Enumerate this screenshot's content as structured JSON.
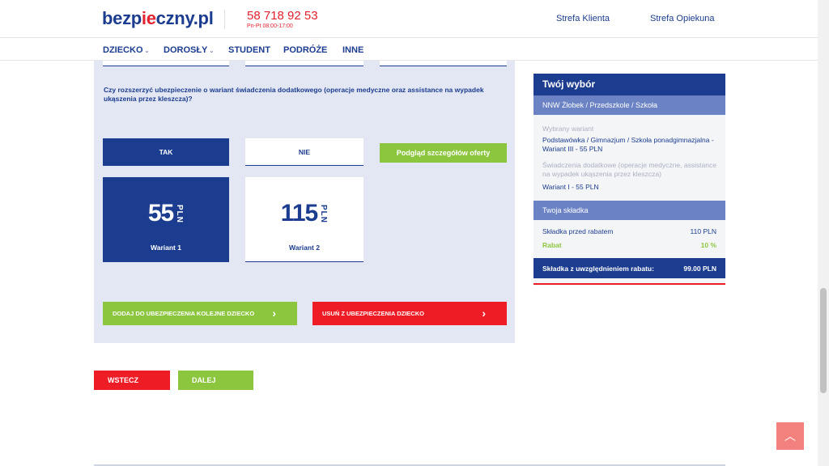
{
  "header": {
    "logo_before": "bezp",
    "logo_accent": "ie",
    "logo_after": "czny.pl",
    "phone": "58 718 92 53",
    "hours": "Pn-Pt 08:00-17:00",
    "links": [
      "Strefa Klienta",
      "Strefa Opiekuna"
    ]
  },
  "nav": {
    "items": [
      {
        "label": "DZIECKO",
        "has_dropdown": true
      },
      {
        "label": "DOROSŁY",
        "has_dropdown": true
      },
      {
        "label": "STUDENT",
        "has_dropdown": false
      },
      {
        "label": "PODRÓŻE",
        "has_dropdown": false
      },
      {
        "label": "INNE",
        "has_dropdown": false
      }
    ]
  },
  "form": {
    "question": "Czy rozszerzyć ubezpieczenie o wariant świadczenia dodatkowego (operacje medyczne oraz assistance na wypadek ukąszenia przez kleszcza)?",
    "yes_label": "TAK",
    "no_label": "NIE",
    "preview_label": "Podgląd szczegółów oferty",
    "selected": "TAK",
    "variants": [
      {
        "amount": "55",
        "currency": "PLN",
        "name": "Wariant 1",
        "selected": true
      },
      {
        "amount": "115",
        "currency": "PLN",
        "name": "Wariant 2",
        "selected": false
      }
    ],
    "add_child_label": "DODAJ DO UBEZPIECZENIA KOLEJNE DZIECKO",
    "remove_child_label": "USUŃ Z UBEZPIECZENIA DZIECKO",
    "arrow_glyph": "›"
  },
  "footer_nav": {
    "back_label": "WSTECZ",
    "next_label": "DALEJ"
  },
  "summary": {
    "title": "Twój wybór",
    "product": "NNW Żłobek / Przedszkole / Szkoła",
    "variant_label": "Wybrany wariant",
    "variant_value": "Podstawówka / Gimnazjum / Szkoła ponadgimnazjalna - Wariant III - 55 PLN",
    "extra_label": "Świadczenia dodatkowe (operacje medyczne, assistance na wypadek ukąszenia przez kleszcza)",
    "extra_value": "Wariant I - 55 PLN",
    "premium_header": "Twoja składka",
    "before_discount_label": "Składka przed rabatem",
    "before_discount_value": "110 PLN",
    "discount_label": "Rabat",
    "discount_value": "10 %",
    "total_label": "Składka z uwzględnieniem rabatu:",
    "total_value": "99.00 PLN"
  },
  "scroll_top_glyph": "︿",
  "colors": {
    "brand_blue": "#1b3c8f",
    "accent_red": "#ee1c25",
    "accent_green": "#8cc63f",
    "panel_bg": "#e3e7f3"
  }
}
